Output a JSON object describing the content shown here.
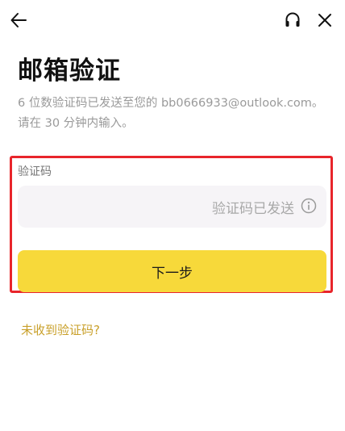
{
  "header": {
    "back_icon": "arrow-left-icon",
    "support_icon": "headset-icon",
    "close_icon": "close-icon"
  },
  "title": "邮箱验证",
  "description": {
    "line1": "6 位数验证码已发送至您的 bb0666933@outlook.com。",
    "line2": "请在 30 分钟内输入。"
  },
  "code_field": {
    "label": "验证码",
    "value": "",
    "status": "验证码已发送",
    "status_icon": "info-circle-icon"
  },
  "next_button_label": "下一步",
  "resend_link": "未收到验证码?",
  "colors": {
    "accent": "#f7d93a",
    "link": "#c9a02a",
    "highlight": "#e8252b"
  }
}
